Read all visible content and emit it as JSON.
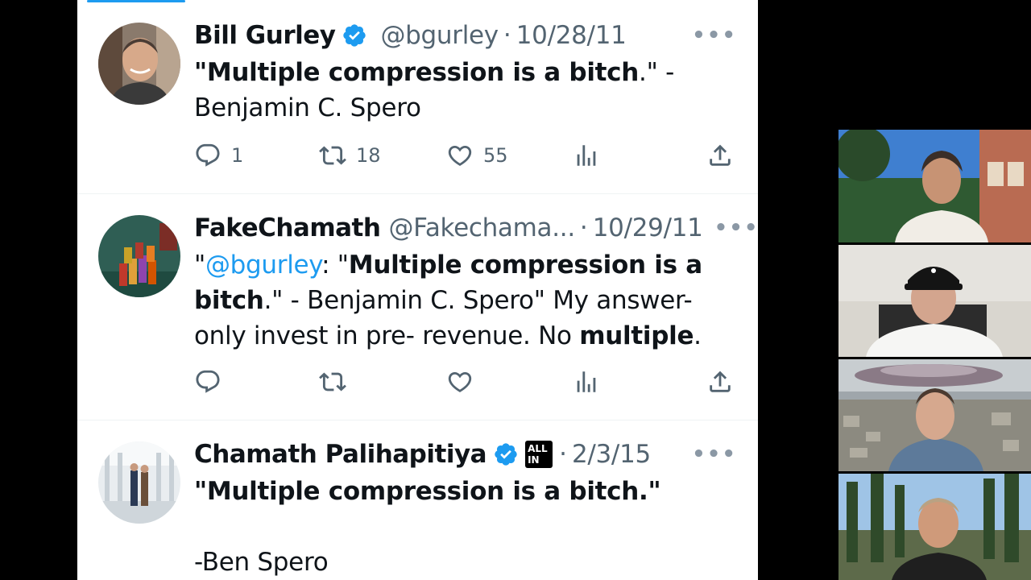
{
  "tweets": [
    {
      "display_name": "Bill Gurley",
      "verified": true,
      "handle": "@bgurley",
      "date": "10/28/11",
      "body_lines": [
        {
          "parts": [
            {
              "bold": true,
              "text": "\"Multiple compression is a bitch"
            },
            {
              "text": ".\" -"
            }
          ]
        },
        {
          "parts": [
            {
              "text": "Benjamin C. Spero"
            }
          ]
        }
      ],
      "counts": {
        "replies": "1",
        "retweets": "18",
        "likes": "55"
      }
    },
    {
      "display_name": "FakeChamath",
      "verified": false,
      "handle": "@Fakechama...",
      "date": "10/29/11",
      "body_segments": {
        "quote_open": "\"",
        "mention": "@bgurley",
        "after_mention": ": \"",
        "bold1": "Multiple compression is a",
        "bold2": "bitch",
        "after_bold": ".\" - Benjamin C. Spero\" My answer-",
        "line3_pre": "only invest in pre- revenue. No ",
        "line3_bold": "multiple",
        "line3_post": "."
      }
    },
    {
      "display_name": "Chamath Palihapitiya",
      "verified": true,
      "badge_text_1": "ALL",
      "badge_text_2": "IN",
      "date": "2/3/15",
      "body_bold": "\"Multiple compression is a bitch.\"",
      "body_line2": "-Ben Spero"
    }
  ],
  "ui": {
    "more_label": "•••",
    "separator": "·"
  },
  "colors": {
    "accent": "#1d9bf0",
    "text": "#0f1419",
    "muted": "#536471",
    "divider": "#eff3f4"
  },
  "icons": [
    "reply-icon",
    "retweet-icon",
    "like-icon",
    "views-icon",
    "share-icon",
    "verified-badge-icon",
    "more-icon"
  ]
}
